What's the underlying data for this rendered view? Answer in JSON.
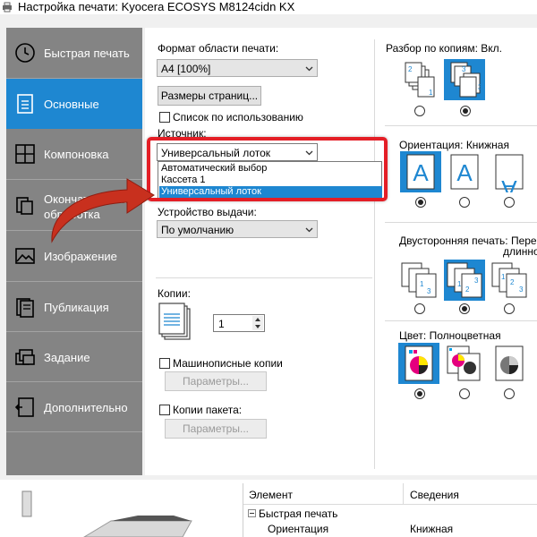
{
  "window": {
    "title": "Настройка печати: Kyocera ECOSYS M8124cidn KX"
  },
  "sidebar": {
    "items": [
      {
        "label": "Быстрая печать"
      },
      {
        "label": "Основные"
      },
      {
        "label": "Компоновка"
      },
      {
        "label": "Окончательная обработка"
      },
      {
        "label": "Изображение"
      },
      {
        "label": "Публикация"
      },
      {
        "label": "Задание"
      },
      {
        "label": "Дополнительно"
      }
    ],
    "active_index": 1
  },
  "basic": {
    "print_area_label": "Формат области печати:",
    "print_area_value": "A4  [100%]",
    "page_sizes_button": "Размеры страниц...",
    "usage_list_label": "Список по использованию",
    "source_label": "Источник:",
    "source_value": "Универсальный лоток",
    "source_options": [
      "Автоматический выбор",
      "Кассета 1",
      "Универсальный лоток"
    ],
    "source_selected_index": 2,
    "output_label": "Устройство выдачи:",
    "output_value": "По умолчанию",
    "copies_label": "Копии:",
    "copies_value": "1",
    "typed_copies_label": "Машинописные копии",
    "typed_params_button": "Параметры...",
    "batch_copies_label": "Копии пакета:",
    "batch_params_button": "Параметры..."
  },
  "collate": {
    "label": "Разбор по копиям:",
    "value": "Вкл.",
    "selected_index": 1
  },
  "orientation": {
    "label": "Ориентация:",
    "value": "Книжная",
    "selected_index": 0
  },
  "duplex": {
    "label": "Двусторонняя печать:",
    "value": "Перево",
    "value_line2": "длинно",
    "selected_index": 1
  },
  "color": {
    "label": "Цвет:",
    "value": "Полноцветная",
    "selected_index": 0
  },
  "summary": {
    "col_item": "Элемент",
    "col_details": "Сведения",
    "group": "Быстрая печать",
    "row_item": "Ориентация",
    "row_value": "Книжная"
  },
  "colors": {
    "accent": "#1e87d1",
    "sidebar": "#848484",
    "highlight": "#e41e26",
    "arrow": "#c8301e"
  },
  "icons": [
    "clock-icon",
    "document-icon",
    "layout-grid-icon",
    "finishing-icon",
    "image-icon",
    "booklet-icon",
    "job-icon",
    "advanced-icon"
  ]
}
